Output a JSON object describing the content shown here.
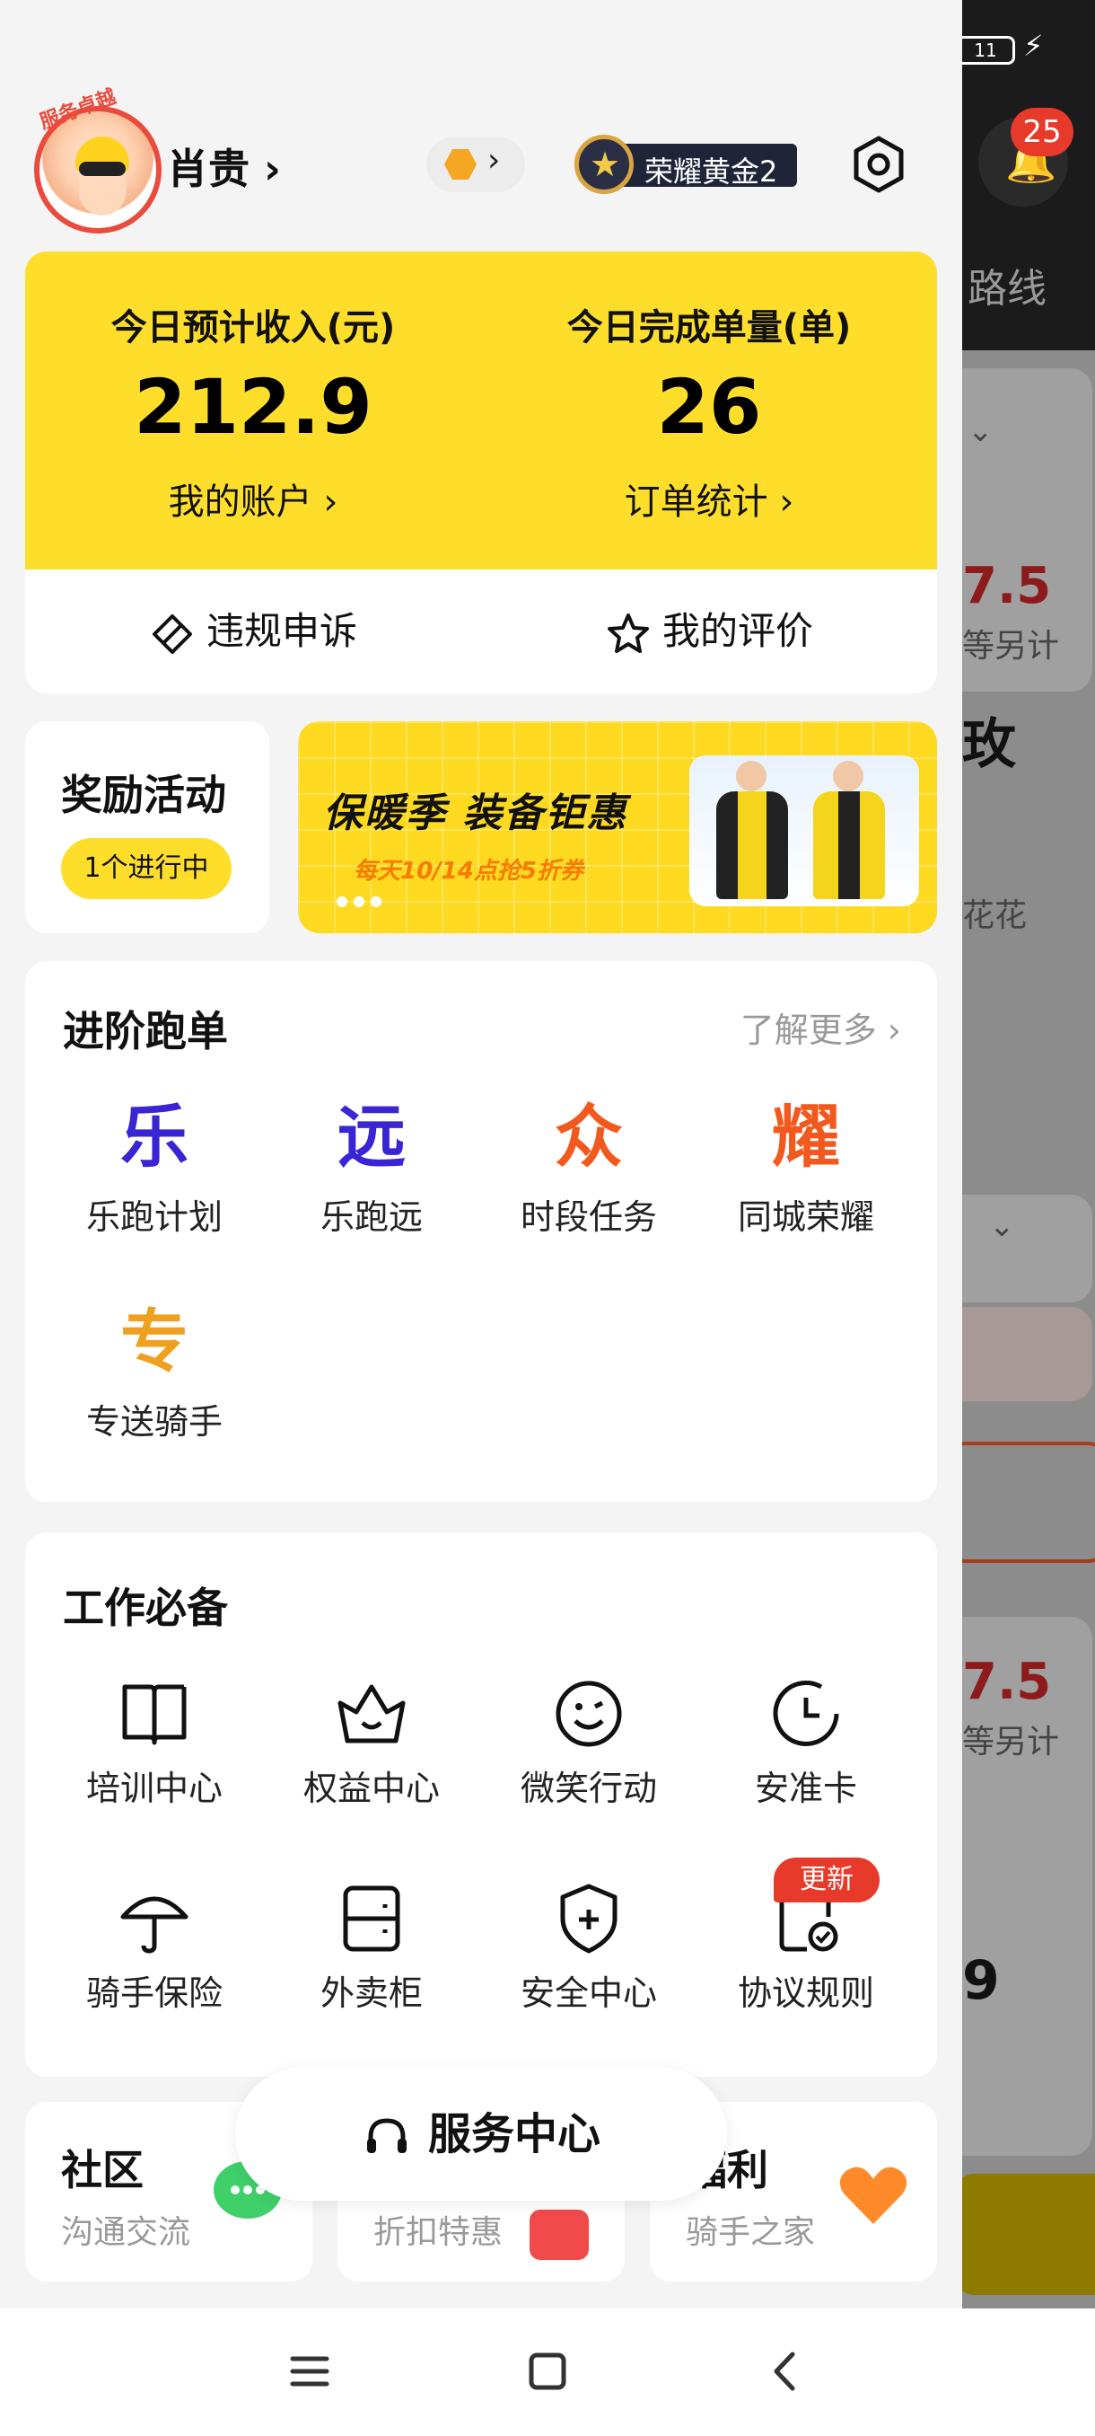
{
  "status": {
    "battery": "11"
  },
  "background_page": {
    "notification_count": "25",
    "route_label": "路线",
    "price_1": "7.5",
    "price_1_note": "等另计",
    "partial_char": "玫",
    "partial_text": "花花",
    "price_2": "7.5",
    "price_2_note": "等另计",
    "partial_num": "9"
  },
  "profile": {
    "name": "肖贵",
    "name_arrow": "›",
    "avatar_tag": "服务卓越",
    "rank": "荣耀黄金2"
  },
  "income": {
    "left": {
      "label": "今日预计收入(元)",
      "value": "212.9",
      "link": "我的账户 ›"
    },
    "right": {
      "label": "今日完成单量(单)",
      "value": "26",
      "link": "订单统计 ›"
    },
    "actions": [
      {
        "label": "违规申诉",
        "icon": "appeal-icon"
      },
      {
        "label": "我的评价",
        "icon": "star-icon"
      }
    ]
  },
  "reward": {
    "title": "奖励活动",
    "pill": "1个进行中"
  },
  "banner": {
    "title": "保暖季 装备钜惠",
    "subtitle": "每天10/14点抢5折券"
  },
  "advance": {
    "title": "进阶跑单",
    "more": "了解更多 ›",
    "items": [
      {
        "char": "乐",
        "label": "乐跑计划",
        "color": "#3a25d4"
      },
      {
        "char": "远",
        "label": "乐跑远",
        "color": "#3a25d4"
      },
      {
        "char": "众",
        "label": "时段任务",
        "color": "#f2591e"
      },
      {
        "char": "耀",
        "label": "同城荣耀",
        "color": "#f2591e"
      },
      {
        "char": "专",
        "label": "专送骑手",
        "color": "#f0a020"
      }
    ]
  },
  "tools": {
    "title": "工作必备",
    "items": [
      {
        "label": "培训中心",
        "icon": "book-icon"
      },
      {
        "label": "权益中心",
        "icon": "crown-icon"
      },
      {
        "label": "微笑行动",
        "icon": "smile-icon"
      },
      {
        "label": "安准卡",
        "icon": "clock-icon"
      },
      {
        "label": "骑手保险",
        "icon": "umbrella-icon"
      },
      {
        "label": "外卖柜",
        "icon": "locker-icon"
      },
      {
        "label": "安全中心",
        "icon": "shield-icon"
      },
      {
        "label": "协议规则",
        "icon": "agreement-icon"
      }
    ],
    "new_tag": "更新"
  },
  "bottom_cards": [
    {
      "title": "社区",
      "subtitle": "沟通交流"
    },
    {
      "title": "",
      "subtitle": "折扣特惠"
    },
    {
      "title": "福利",
      "subtitle": "骑手之家"
    }
  ],
  "service": {
    "label": "服务中心"
  },
  "colors": {
    "accent_yellow": "#fede2b",
    "badge_red": "#e83a2a",
    "purple": "#3a25d4",
    "orange": "#f2591e"
  }
}
